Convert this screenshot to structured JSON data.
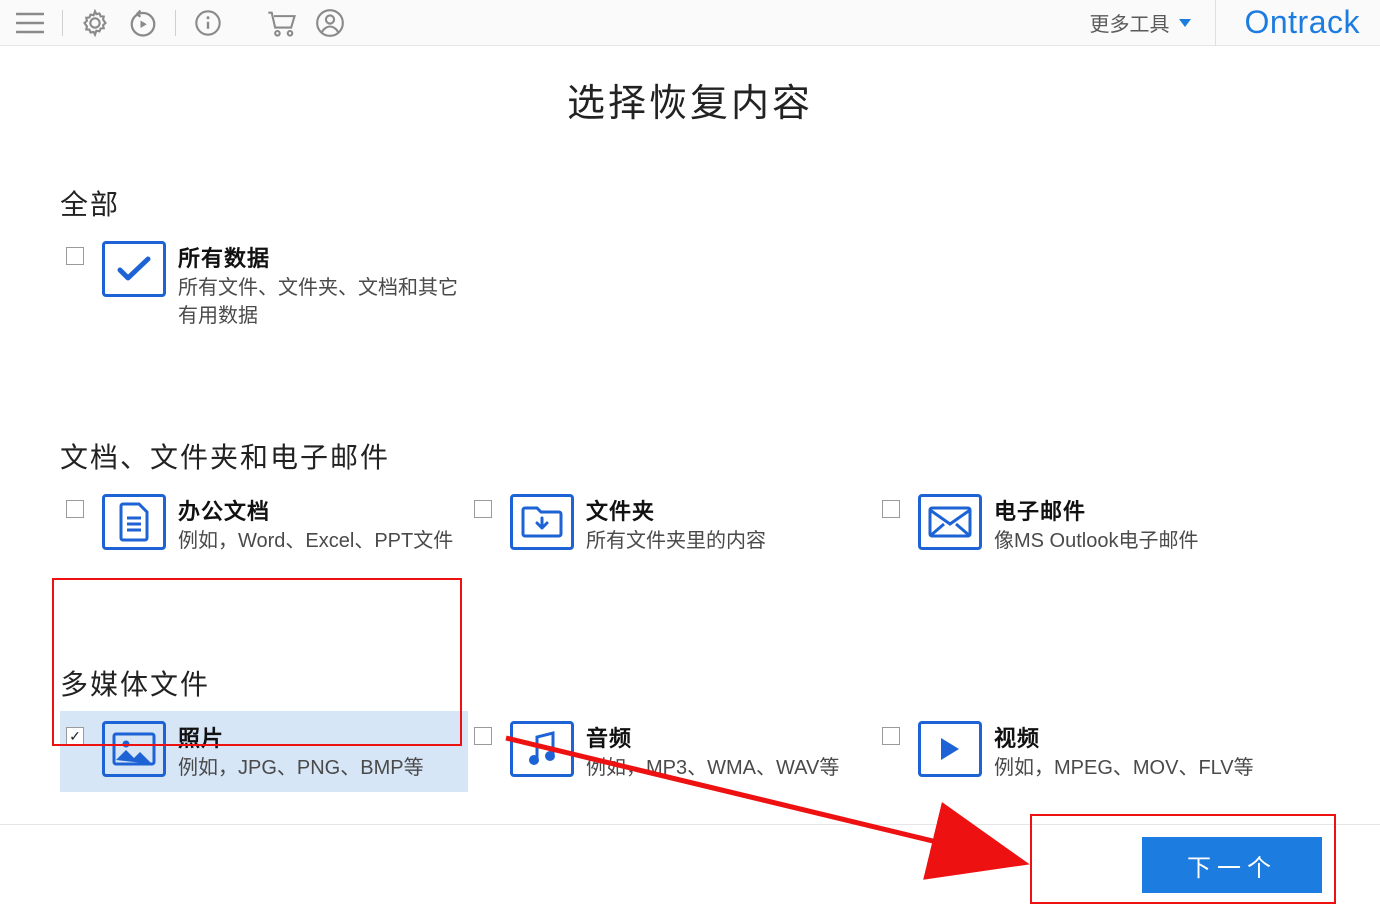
{
  "topbar": {
    "more_tools": "更多工具",
    "brand": "Ontrack"
  },
  "page": {
    "title": "选择恢复内容"
  },
  "sections": {
    "all": {
      "title": "全部"
    },
    "docs": {
      "title": "文档、文件夹和电子邮件"
    },
    "media": {
      "title": "多媒体文件"
    }
  },
  "options": {
    "all_data": {
      "title": "所有数据",
      "desc": "所有文件、文件夹、文档和其它有用数据",
      "checked": false
    },
    "office": {
      "title": "办公文档",
      "desc": "例如，Word、Excel、PPT文件",
      "checked": false
    },
    "folders": {
      "title": "文件夹",
      "desc": "所有文件夹里的内容",
      "checked": false
    },
    "emails": {
      "title": "电子邮件",
      "desc": "像MS Outlook电子邮件",
      "checked": false
    },
    "photos": {
      "title": "照片",
      "desc": "例如，JPG、PNG、BMP等",
      "checked": true
    },
    "audio": {
      "title": "音频",
      "desc": "例如，MP3、WMA、WAV等",
      "checked": false
    },
    "video": {
      "title": "视频",
      "desc": "例如，MPEG、MOV、FLV等",
      "checked": false
    }
  },
  "footer": {
    "next": "下一个"
  },
  "colors": {
    "brand": "#1d7ce0",
    "iconBorder": "#1d63d6",
    "annotation": "#e11111"
  }
}
